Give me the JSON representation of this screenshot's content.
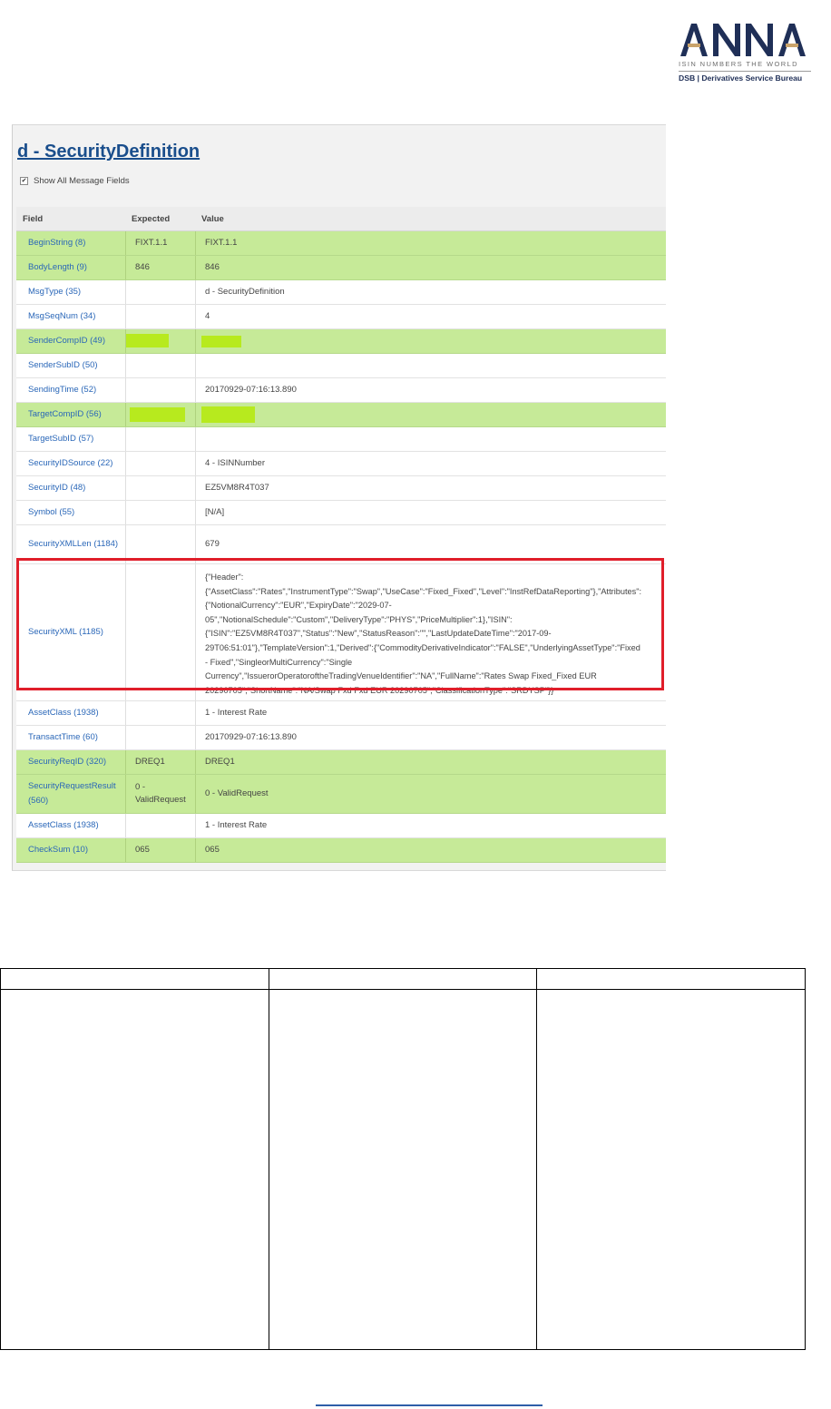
{
  "logo": {
    "wordmark": "ANNA",
    "tagline": "ISIN NUMBERS THE WORLD",
    "dsb_line": "DSB | Derivatives Service Bureau",
    "colors": {
      "wordmark": "#1f2f57",
      "accent": "#c9a36b"
    }
  },
  "screen": {
    "title": "d - SecurityDefinition",
    "show_all_label": "Show All Message Fields",
    "show_all_checked": true,
    "columns": {
      "field": "Field",
      "expected": "Expected",
      "value": "Value"
    },
    "rows": [
      {
        "field": "BeginString (8)",
        "expected": "FIXT.1.1",
        "value": "FIXT.1.1",
        "match": true
      },
      {
        "field": "BodyLength (9)",
        "expected": "846",
        "value": "846",
        "match": true
      },
      {
        "field": "MsgType (35)",
        "expected": "",
        "value": "d - SecurityDefinition",
        "match": false
      },
      {
        "field": "MsgSeqNum (34)",
        "expected": "",
        "value": "4",
        "match": false
      },
      {
        "field": "SenderCompID (49)",
        "expected": "",
        "value": "",
        "match": true,
        "redacted": true
      },
      {
        "field": "SenderSubID (50)",
        "expected": "",
        "value": "",
        "match": false
      },
      {
        "field": "SendingTime (52)",
        "expected": "",
        "value": "20170929-07:16:13.890",
        "match": false
      },
      {
        "field": "TargetCompID (56)",
        "expected": "",
        "value": "",
        "match": true,
        "redacted": true
      },
      {
        "field": "TargetSubID (57)",
        "expected": "",
        "value": "",
        "match": false
      },
      {
        "field": "SecurityIDSource (22)",
        "expected": "",
        "value": "4 - ISINNumber",
        "match": false
      },
      {
        "field": "SecurityID (48)",
        "expected": "",
        "value": "EZ5VM8R4T037",
        "match": false
      },
      {
        "field": "Symbol (55)",
        "expected": "",
        "value": "[N/A]",
        "match": false
      },
      {
        "field": "SecurityXMLLen (1184)",
        "expected": "",
        "value": "679",
        "match": false
      },
      {
        "field": "SecurityXML (1185)",
        "expected": "",
        "match": false,
        "highlighted": true,
        "value_lines": [
          "{\"Header\":",
          "{\"AssetClass\":\"Rates\",\"InstrumentType\":\"Swap\",\"UseCase\":\"Fixed_Fixed\",\"Level\":\"InstRefDataReporting\"},\"Attributes\":",
          "{\"NotionalCurrency\":\"EUR\",\"ExpiryDate\":\"2029-07-",
          "05\",\"NotionalSchedule\":\"Custom\",\"DeliveryType\":\"PHYS\",\"PriceMultiplier\":1},\"ISIN\":",
          "{\"ISIN\":\"EZ5VM8R4T037\",\"Status\":\"New\",\"StatusReason\":\"\",\"LastUpdateDateTime\":\"2017-09-",
          "29T06:51:01\"},\"TemplateVersion\":1,\"Derived\":{\"CommodityDerivativeIndicator\":\"FALSE\",\"UnderlyingAssetType\":\"Fixed",
          "- Fixed\",\"SingleorMultiCurrency\":\"Single",
          "Currency\",\"IssuerorOperatoroftheTradingVenueIdentifier\":\"NA\",\"FullName\":\"Rates Swap Fixed_Fixed EUR",
          "20290705\",\"ShortName\":\"NA/Swap Fxd Fxd EUR 20290705\",\"ClassificationType\":\"SRDYSP\"}}"
        ]
      },
      {
        "field": "AssetClass (1938)",
        "expected": "",
        "value": "1 - Interest Rate",
        "match": false
      },
      {
        "field": "TransactTime (60)",
        "expected": "",
        "value": "20170929-07:16:13.890",
        "match": false
      },
      {
        "field": "SecurityReqID (320)",
        "expected": "DREQ1",
        "value": "DREQ1",
        "match": true
      },
      {
        "field": "SecurityRequestResult (560)",
        "expected": "0 - ValidRequest",
        "value": "0 - ValidRequest",
        "match": true
      },
      {
        "field": "AssetClass (1938)",
        "expected": "",
        "value": "1 - Interest Rate",
        "match": false
      },
      {
        "field": "CheckSum (10)",
        "expected": "065",
        "value": "065",
        "match": true
      }
    ],
    "colors": {
      "match_row": "#c6ea98",
      "redaction": "#b7ea1e",
      "highlight_border": "#e01e2a",
      "title": "#1a4e8c",
      "field_link": "#2a67b8"
    }
  },
  "empty_table": {
    "columns": 3,
    "header_cells": [
      "",
      "",
      ""
    ],
    "body_cells": [
      "",
      "",
      ""
    ]
  }
}
